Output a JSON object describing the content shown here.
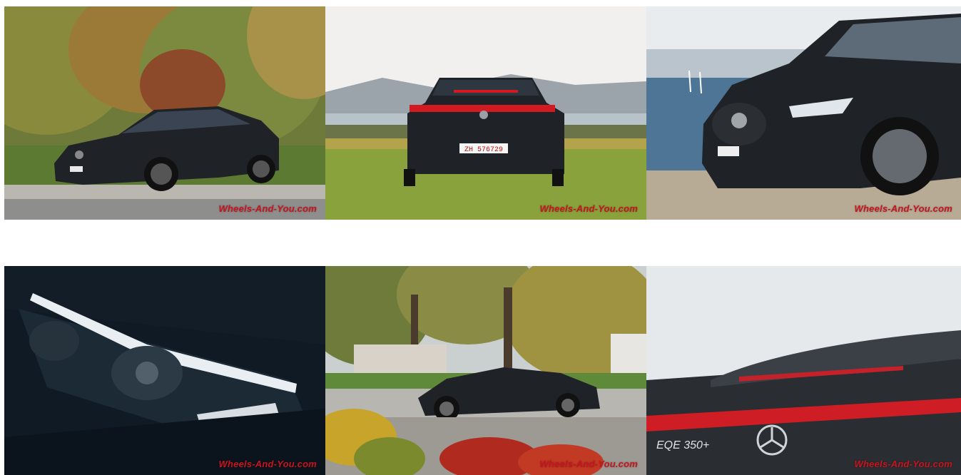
{
  "gallery": {
    "photos": [
      {
        "subject": "Mercedes EQE front three-quarter view, autumn trees",
        "watermark": "Wheels-And-You.com"
      },
      {
        "subject": "Mercedes EQE rear view on grass, lake and mountains",
        "watermark": "Wheels-And-You.com",
        "plate": "ZH 576729"
      },
      {
        "subject": "Mercedes EQE front detail by the lake",
        "watermark": "Wheels-And-You.com"
      },
      {
        "subject": "Mercedes EQE headlight detail",
        "watermark": "Wheels-And-You.com"
      },
      {
        "subject": "Mercedes EQE side view in park with autumn leaves",
        "watermark": "Wheels-And-You.com"
      },
      {
        "subject": "Mercedes EQE rear light bar and badge detail",
        "watermark": "Wheels-And-You.com",
        "badge": "EQE 350+"
      }
    ]
  },
  "colors": {
    "car_paint": "#1f2226",
    "watermark_red": "#c8141e",
    "tail_light": "#d21a22"
  }
}
